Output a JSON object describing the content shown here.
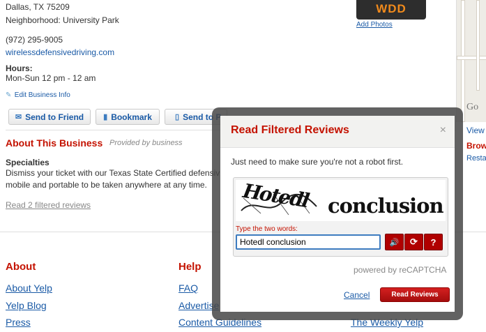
{
  "business": {
    "address_line": "Dallas, TX 75209",
    "neighborhood": "Neighborhood: University Park",
    "phone": "(972) 295-9005",
    "website": "wirelessdefensivedriving.com",
    "hours_label": "Hours:",
    "hours_value": "Mon-Sun 12 pm - 12 am",
    "edit_link": "Edit Business Info",
    "photo_logo_text": "WDD",
    "add_photos": "Add Photos"
  },
  "actions": {
    "send_to_friend": "Send to Friend",
    "bookmark": "Bookmark",
    "send_to_phone": "Send to P"
  },
  "about": {
    "title": "About This Business",
    "provided_by": "Provided by business",
    "specialties_label": "Specialties",
    "specialties_line1": "Dismiss your ticket with our Texas State Certified defensiv",
    "specialties_line2": "mobile and portable to be taken anywhere at any time.",
    "filtered_reviews": "Read 2 filtered reviews"
  },
  "right_stub": {
    "view": "View",
    "brow": "Brow",
    "resta": "Resta",
    "map_label": "Go"
  },
  "footer": {
    "col1_heading": "About",
    "col1_links": [
      "About Yelp",
      "Yelp Blog",
      "Press"
    ],
    "col2_heading": "Help",
    "col2_links": [
      "FAQ",
      "Advertise",
      "Content Guidelines"
    ],
    "col3_link_last": "The Weekly Yelp"
  },
  "dialog": {
    "title": "Read Filtered Reviews",
    "close_glyph": "×",
    "message": "Just need to make sure you're not a robot first.",
    "captcha_word1": "Hotedl",
    "captcha_word2": "conclusion",
    "captcha_label": "Type the two words:",
    "captcha_value": "Hotedl conclusion",
    "audio_glyph": "🔊",
    "refresh_glyph": "⟳",
    "help_glyph": "?",
    "powered_by": "powered by reCAPTCHA",
    "cancel": "Cancel",
    "submit": "Read Reviews"
  },
  "colors": {
    "brand_red": "#c41200",
    "link_blue": "#1a5aa6",
    "captcha_button_red": "#b00000"
  }
}
